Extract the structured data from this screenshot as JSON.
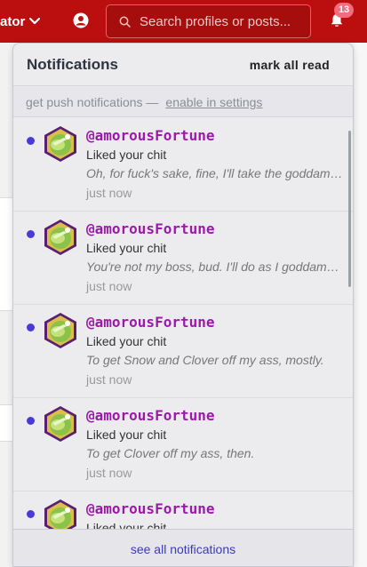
{
  "topbar": {
    "user_label": "ator",
    "search_placeholder": "Search profiles or posts...",
    "notification_count": "13"
  },
  "panel": {
    "title": "Notifications",
    "mark_all_read": "mark all read",
    "push_text": "get push notifications —",
    "push_link": "enable in settings",
    "footer_link": "see all notifications"
  },
  "notifications": [
    {
      "handle": "@amorousFortune",
      "action": "Liked your chit",
      "snippet": "Oh, for fuck's sake, fine, I'll take the goddamn thing.",
      "time": "just now"
    },
    {
      "handle": "@amorousFortune",
      "action": "Liked your chit",
      "snippet": "You're not my boss, bud. I'll do as I goddamn please.",
      "time": "just now"
    },
    {
      "handle": "@amorousFortune",
      "action": "Liked your chit",
      "snippet": "To get Snow and Clover off my ass, mostly.",
      "time": "just now"
    },
    {
      "handle": "@amorousFortune",
      "action": "Liked your chit",
      "snippet": "To get Clover off my ass, then.",
      "time": "just now"
    },
    {
      "handle": "@amorousFortune",
      "action": "Liked your chit",
      "snippet": "",
      "time": ""
    }
  ],
  "colors": {
    "topbar": "#bb0f0f",
    "unread_dot": "#4b3bd6",
    "handle": "#9b1aa8",
    "badge": "#f26c7e"
  }
}
